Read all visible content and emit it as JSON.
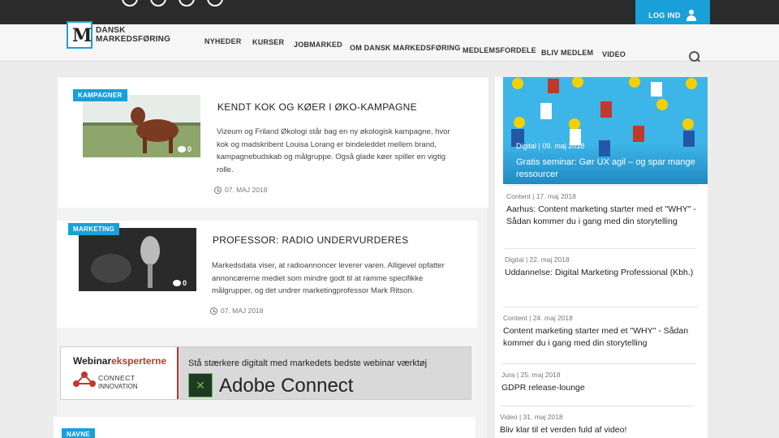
{
  "header": {
    "login_label": "LOG IND",
    "logo_line1": "DANSK",
    "logo_line2": "MARKEDSFØRING",
    "nav": [
      "NYHEDER",
      "KURSER",
      "JOBMARKED",
      "OM DANSK MARKEDSFØRING",
      "MEDLEMSFORDELE",
      "BLIV MEDLEM",
      "VIDEO"
    ]
  },
  "articles": [
    {
      "badge": "KAMPAGNER",
      "title": "KENDT KOK OG KØER I ØKO-KAMPAGNE",
      "text": "Vizeum og Friland Økologi står bag en ny økologisk kampagne, hvor kok og madskribent Louisa Lorang er bindeleddet mellem brand, kampagnebudskab og målgruppe. Også glade køer spiller en vigtig rolle.",
      "date": "07. MAJ 2018",
      "comments": "0"
    },
    {
      "badge": "MARKETING",
      "title": "PROFESSOR: RADIO UNDERVURDERES",
      "text": "Markedsdata viser, at radioannoncer leverer varen. Alligevel opfatter annoncørerne mediet som mindre godt til at ramme specifikke målgrupper, og det undrer marketingprofessor Mark Ritson.",
      "date": "07. MAJ 2018",
      "comments": "0"
    }
  ],
  "banner": {
    "brand_a": "Webinar",
    "brand_b": "eksperterne",
    "connect": "CONNECT",
    "innovation": "INNOVATION",
    "tagline": "Stå stærkere digitalt med markedets bedste webinar værktøj",
    "product": "Adobe Connect"
  },
  "third_badge": "NAVNE",
  "sidebar": {
    "hero": {
      "category": "Digital | 09. maj 2018",
      "title": "Gratis seminar: Gør UX agil – og spar mange ressourcer"
    },
    "items": [
      {
        "category": "Content | 17. maj 2018",
        "title": "Aarhus: Content marketing starter med et \"WHY\" - Sådan kommer du i gang med din storytelling"
      },
      {
        "category": "Digital | 22. maj 2018",
        "title": "Uddannelse: Digital Marketing Professional (Kbh.)"
      },
      {
        "category": "Content | 24. maj 2018",
        "title": "Content marketing starter med et \"WHY\" - Sådan kommer du i gang med din storytelling"
      },
      {
        "category": "Jura | 25. maj 2018",
        "title": "GDPR release-lounge"
      },
      {
        "category": "Video | 31. maj 2018",
        "title": "Bliv klar til et verden fuld af video!"
      }
    ]
  },
  "colors": {
    "accent": "#1a9fd9",
    "topbar": "#2b2b2b",
    "banner_red": "#c0392b"
  }
}
